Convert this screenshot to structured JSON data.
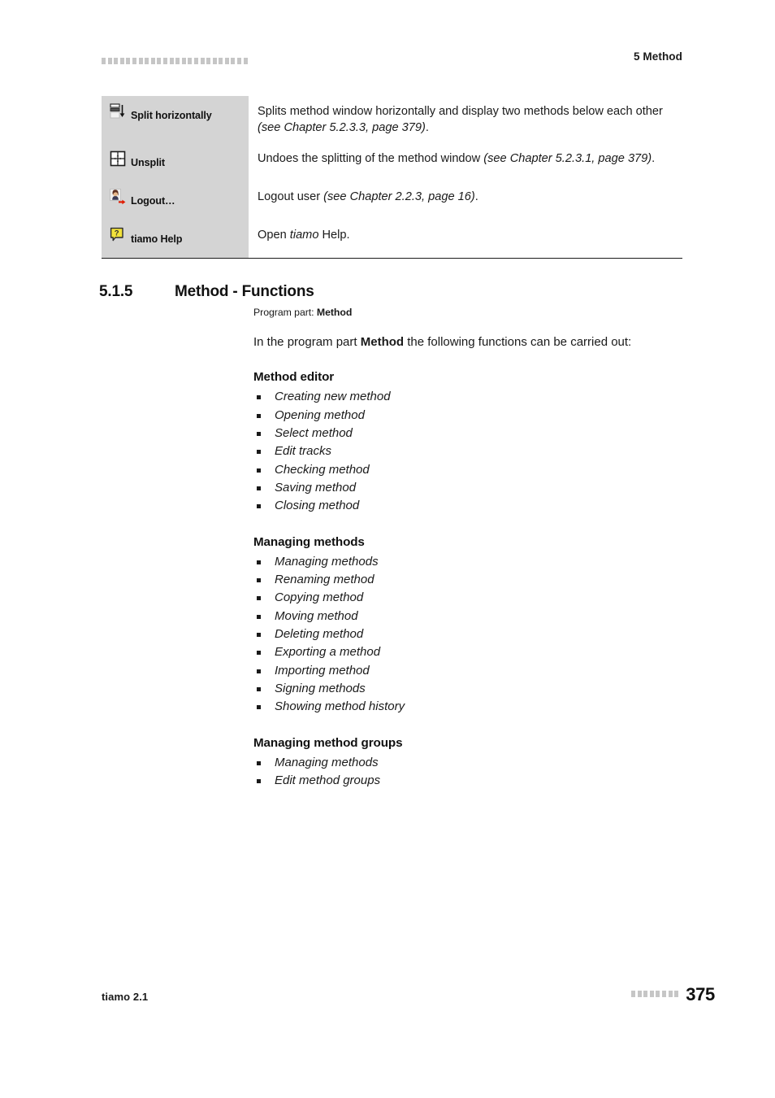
{
  "header": {
    "deco_squares": 24,
    "title": "5 Method"
  },
  "icon_table": {
    "rows": [
      {
        "icon": "split-horizontally-icon",
        "label": "Split horizontally",
        "description_parts": [
          {
            "text": "Splits method window horizontally and display two methods below each other ",
            "style": "normal"
          },
          {
            "text": "(see Chapter 5.2.3.3, page 379)",
            "style": "italic"
          },
          {
            "text": ".",
            "style": "normal"
          }
        ]
      },
      {
        "icon": "unsplit-icon",
        "label": "Unsplit",
        "description_parts": [
          {
            "text": "Undoes the splitting of the method window ",
            "style": "normal"
          },
          {
            "text": "(see Chapter 5.2.3.1, page 379)",
            "style": "italic"
          },
          {
            "text": ".",
            "style": "normal"
          }
        ]
      },
      {
        "icon": "logout-icon",
        "label": "Logout…",
        "description_parts": [
          {
            "text": "Logout user ",
            "style": "normal"
          },
          {
            "text": "(see Chapter 2.2.3, page 16)",
            "style": "italic"
          },
          {
            "text": ".",
            "style": "normal"
          }
        ]
      },
      {
        "icon": "tiamo-help-icon",
        "label": "tiamo Help",
        "description_parts": [
          {
            "text": "Open ",
            "style": "normal"
          },
          {
            "text": "tiamo",
            "style": "italic"
          },
          {
            "text": " Help.",
            "style": "normal"
          }
        ]
      }
    ]
  },
  "section": {
    "number": "5.1.5",
    "title": "Method - Functions",
    "program_part_label": "Program part: ",
    "program_part_value": "Method",
    "intro_parts": [
      {
        "text": "In the program part ",
        "style": "normal"
      },
      {
        "text": "Method",
        "style": "bold"
      },
      {
        "text": " the following functions can be carried out:",
        "style": "normal"
      }
    ]
  },
  "groups": [
    {
      "title": "Method editor",
      "items": [
        "Creating new method",
        "Opening method",
        "Select method",
        "Edit tracks",
        "Checking method",
        "Saving method",
        "Closing method"
      ]
    },
    {
      "title": "Managing methods",
      "items": [
        "Managing methods",
        "Renaming method",
        "Copying method",
        "Moving method",
        "Deleting method",
        "Exporting a method",
        "Importing method",
        "Signing methods",
        "Showing method history"
      ]
    },
    {
      "title": "Managing method groups",
      "items": [
        "Managing methods",
        "Edit method groups"
      ]
    }
  ],
  "footer": {
    "product": "tiamo 2.1",
    "deco_squares": 8,
    "page_number": "375"
  },
  "colors": {
    "icon_cell_background": "#d4d4d4",
    "deco_square": "#c6c6c6",
    "text": "#1a1a1a",
    "help_icon_yellow": "#f2e23a",
    "logout_arrow_red": "#e01b00"
  }
}
